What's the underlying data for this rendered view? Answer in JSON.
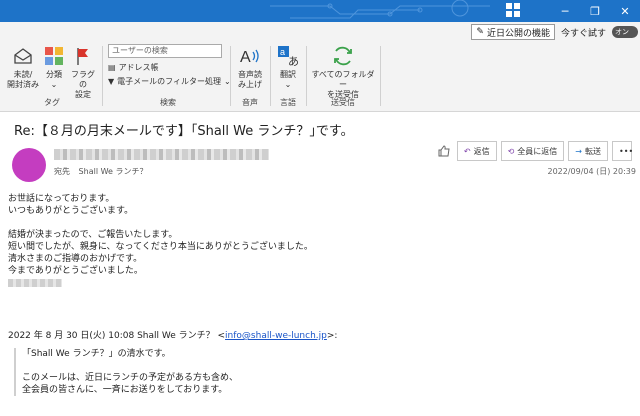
{
  "titlebar": {
    "accent": "#1e73c8"
  },
  "ribbon": {
    "recent_features": "近日公開の機能",
    "quick_help": "今すぐ試す",
    "toggle": "オン",
    "groups": {
      "tags": {
        "label": "タグ",
        "unread": [
          "未読/",
          "開封済み"
        ],
        "categorize": "分類",
        "flag": [
          "フラグの",
          "設定"
        ]
      },
      "search": {
        "label": "検索",
        "placeholder": "ユーザーの検索",
        "address_book": "アドレス帳",
        "filter_email": "電子メールのフィルター処理"
      },
      "speech": {
        "label": "音声",
        "read_aloud": [
          "音声読",
          "み上げ"
        ]
      },
      "language": {
        "label": "言語",
        "translate": "翻訳"
      },
      "send_receive": {
        "label": "送受信",
        "all_folders": [
          "すべてのフォルダー",
          "を送受信"
        ]
      }
    }
  },
  "mail": {
    "subject": "Re:【８月の月末メールです】｢Shall We ランチ？｣です。",
    "to_label": "宛先",
    "to_value": "Shall We ランチ？",
    "actions": {
      "reply": "返信",
      "reply_all": "全員に返信",
      "forward": "転送"
    },
    "datetime": "2022/09/04 (日) 20:39",
    "body": [
      "お世話になっております。",
      "いつもありがとうございます。",
      "",
      "結婚が決まったので、ご報告いたします。",
      "短い間でしたが、親身に、なってくださり本当にありがとうございました。",
      "清水さまのご指導のおかげです。",
      "今までありがとうございました。"
    ],
    "quote_header_text": "2022 年 8 月 30 日(火) 10:08 Shall We ランチ？ <",
    "quote_email": "info@shall-we-lunch.jp",
    "quote_header_end": ">:",
    "quote": [
      "「Shall We ランチ？」の清水です。",
      "",
      "このメールは、近日にランチの予定がある方も含め、",
      "全会員の皆さんに、一斉にお送りをしております。"
    ]
  }
}
